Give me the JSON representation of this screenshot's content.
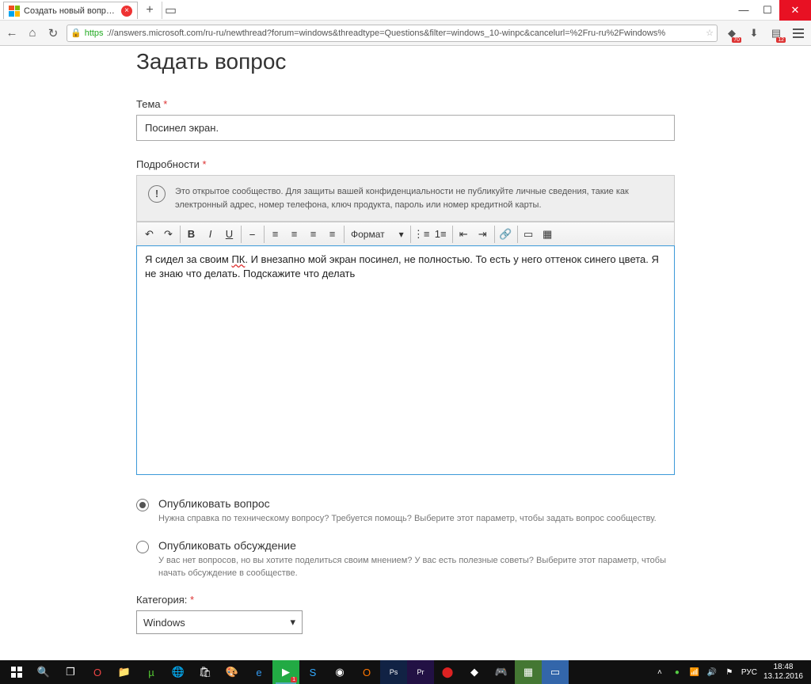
{
  "browser": {
    "tab_title": "Создать новый вопрос ил",
    "url_proto": "https",
    "url": "://answers.microsoft.com/ru-ru/newthread?forum=windows&threadtype=Questions&filter=windows_10-winpc&cancelurl=%2Fru-ru%2Fwindows%",
    "ext_badges": [
      "70",
      "12"
    ]
  },
  "page": {
    "title": "Задать вопрос",
    "theme_label": "Тема",
    "theme_value": "Посинел экран.",
    "details_label": "Подробности",
    "notice": "Это открытое сообщество. Для защиты вашей конфиденциальности не публикуйте личные сведения, такие как электронный адрес, номер телефона, ключ продукта, пароль или номер кредитной карты.",
    "format_label": "Формат",
    "editor_pre": "Я сидел за своим ",
    "editor_err": "ПК",
    "editor_post": ". И внезапно мой экран посинел, не полностью. То есть у него оттенок синего цвета. Я не знаю что делать. Подскажите что делать",
    "radios": [
      {
        "title": "Опубликовать вопрос",
        "desc": "Нужна справка по техническому вопросу? Требуется помощь? Выберите этот параметр, чтобы задать вопрос сообществу."
      },
      {
        "title": "Опубликовать обсуждение",
        "desc": "У вас нет вопросов, но вы хотите поделиться своим мнением? У вас есть полезные советы? Выберите этот параметр, чтобы начать обсуждение в сообществе."
      }
    ],
    "category_label": "Категория:",
    "category_value": "Windows"
  },
  "tray": {
    "lang": "РУС",
    "time": "18:48",
    "date": "13.12.2016"
  }
}
